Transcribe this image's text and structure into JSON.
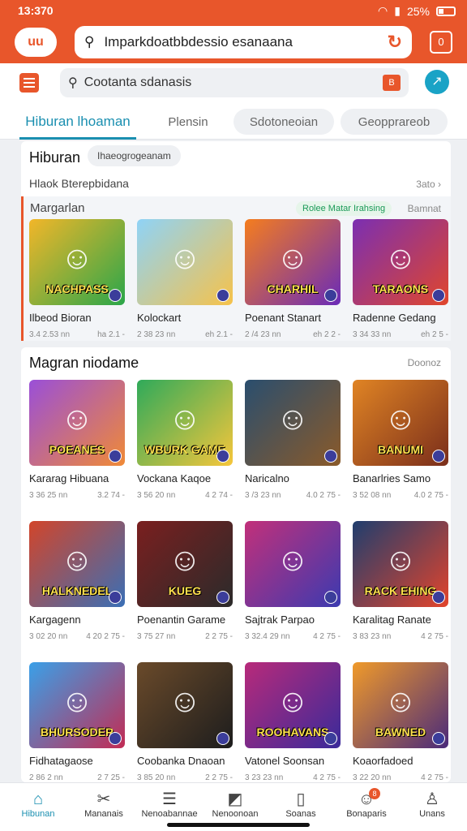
{
  "status": {
    "time": "13:370",
    "battery": "25%"
  },
  "browser": {
    "logo": "uu",
    "url": "Imparkdoatbbdessio esanaana",
    "tabs_count": "0"
  },
  "search": {
    "query": "Cootanta sdanasis",
    "book": "B",
    "share": "↗"
  },
  "tabs": [
    {
      "label": "Hiburan lhoaman"
    },
    {
      "label": "Plensin"
    },
    {
      "label": "Sdotoneoian"
    },
    {
      "label": "Geopprareob"
    }
  ],
  "section1": {
    "title": "Hiburan",
    "chip": "Ihaeogrogeanam",
    "subtitle": "Hlaok Bterepbidana",
    "more": "3ato",
    "row_label": "Margarlan",
    "row_green": "Rolee Matar Irahsing",
    "row_right": "Bamnat",
    "games": [
      {
        "name": "Ilbeod Bioran",
        "meta1": "3.4 2.53 nn",
        "meta2": "ha 2.1 -",
        "word": "NACHPASS",
        "c1": "#f2b629",
        "c2": "#2aa64a"
      },
      {
        "name": "Kolockart",
        "meta1": "2 38 23 nn",
        "meta2": "eh 2.1 -",
        "word": "",
        "c1": "#8fd3f7",
        "c2": "#f6c24a"
      },
      {
        "name": "Poenant Stanart",
        "meta1": "2 /4 23 nn",
        "meta2": "eh 2 2 -",
        "word": "CHARHIL",
        "c1": "#f57d1e",
        "c2": "#6a2bb8"
      },
      {
        "name": "Radenne Gedang",
        "meta1": "3 34 33 nn",
        "meta2": "eh 2 5 -",
        "word": "TARAONS",
        "c1": "#7b2fb2",
        "c2": "#e0462c"
      }
    ]
  },
  "section2": {
    "title": "Magran niodame",
    "more": "Doonoz",
    "games": [
      {
        "name": "Kararag Hibuana",
        "meta1": "3 36 25 nn",
        "meta2": "3.2 74 -",
        "word": "POEANES",
        "c1": "#9a4fd8",
        "c2": "#f08a36"
      },
      {
        "name": "Vockana Kaqoe",
        "meta1": "3 56 20 nn",
        "meta2": "4 2 74 -",
        "word": "WBURK GAME",
        "c1": "#2faa5a",
        "c2": "#f6c63b"
      },
      {
        "name": "Naricalno",
        "meta1": "3 /3 23 nn",
        "meta2": "4.0 2 75 -",
        "word": "",
        "c1": "#2a4e6e",
        "c2": "#8a5a2a"
      },
      {
        "name": "Banarlries Samo",
        "meta1": "3 52 08 nn",
        "meta2": "4.0 2 75 -",
        "word": "BANUMI",
        "c1": "#e08424",
        "c2": "#7a2e1b"
      },
      {
        "name": "Kargagenn",
        "meta1": "3 02 20 nn",
        "meta2": "4 20 2 75 -",
        "word": "HALKNEDEL",
        "c1": "#d2452a",
        "c2": "#3a6fb6"
      },
      {
        "name": "Poenantin Garame",
        "meta1": "3 75 27 nn",
        "meta2": "2 2 75 -",
        "word": "KUEG",
        "c1": "#7a1f1f",
        "c2": "#2b2b2b"
      },
      {
        "name": "Sajtrak Parpao",
        "meta1": "3 32.4 29 nn",
        "meta2": "4 2 75 -",
        "word": "",
        "c1": "#c2307a",
        "c2": "#3c3ab0"
      },
      {
        "name": "Karalitag Ranate",
        "meta1": "3 83 23 nn",
        "meta2": "4 2 75 -",
        "word": "RACK EHING",
        "c1": "#1f3e6e",
        "c2": "#e2442c"
      },
      {
        "name": "Fidhatagaose",
        "meta1": "2 86 2 nn",
        "meta2": "2 7 25 -",
        "word": "BHURSODER",
        "c1": "#3aa0e8",
        "c2": "#c22c54"
      },
      {
        "name": "Coobanka Dnaoan",
        "meta1": "3 85 20 nn",
        "meta2": "2 2 75 -",
        "word": "",
        "c1": "#6a4a2a",
        "c2": "#1d1d1d"
      },
      {
        "name": "Vatonel Soonsan",
        "meta1": "3 23 23 nn",
        "meta2": "4 2 75 -",
        "word": "ROOHAVANS",
        "c1": "#b82a7a",
        "c2": "#3a2a9a"
      },
      {
        "name": "Koaorfadoed",
        "meta1": "3 22 20 nn",
        "meta2": "4 2 75 -",
        "word": "BAWNED",
        "c1": "#f09a2a",
        "c2": "#4a2a7a"
      }
    ]
  },
  "nav": [
    {
      "label": "Hibunan",
      "icon": "home-icon",
      "glyph": "⌂"
    },
    {
      "label": "Mananais",
      "icon": "tools-icon",
      "glyph": "✂"
    },
    {
      "label": "Nenoabannae",
      "icon": "list-icon",
      "glyph": "☰"
    },
    {
      "label": "Nenoonoan",
      "icon": "chart-icon",
      "glyph": "◩"
    },
    {
      "label": "Soanas",
      "icon": "bag-icon",
      "glyph": "▯"
    },
    {
      "label": "Bonaparis",
      "icon": "group-icon",
      "glyph": "☺",
      "badge": "8"
    },
    {
      "label": "Unans",
      "icon": "user-icon",
      "glyph": "♙"
    }
  ]
}
